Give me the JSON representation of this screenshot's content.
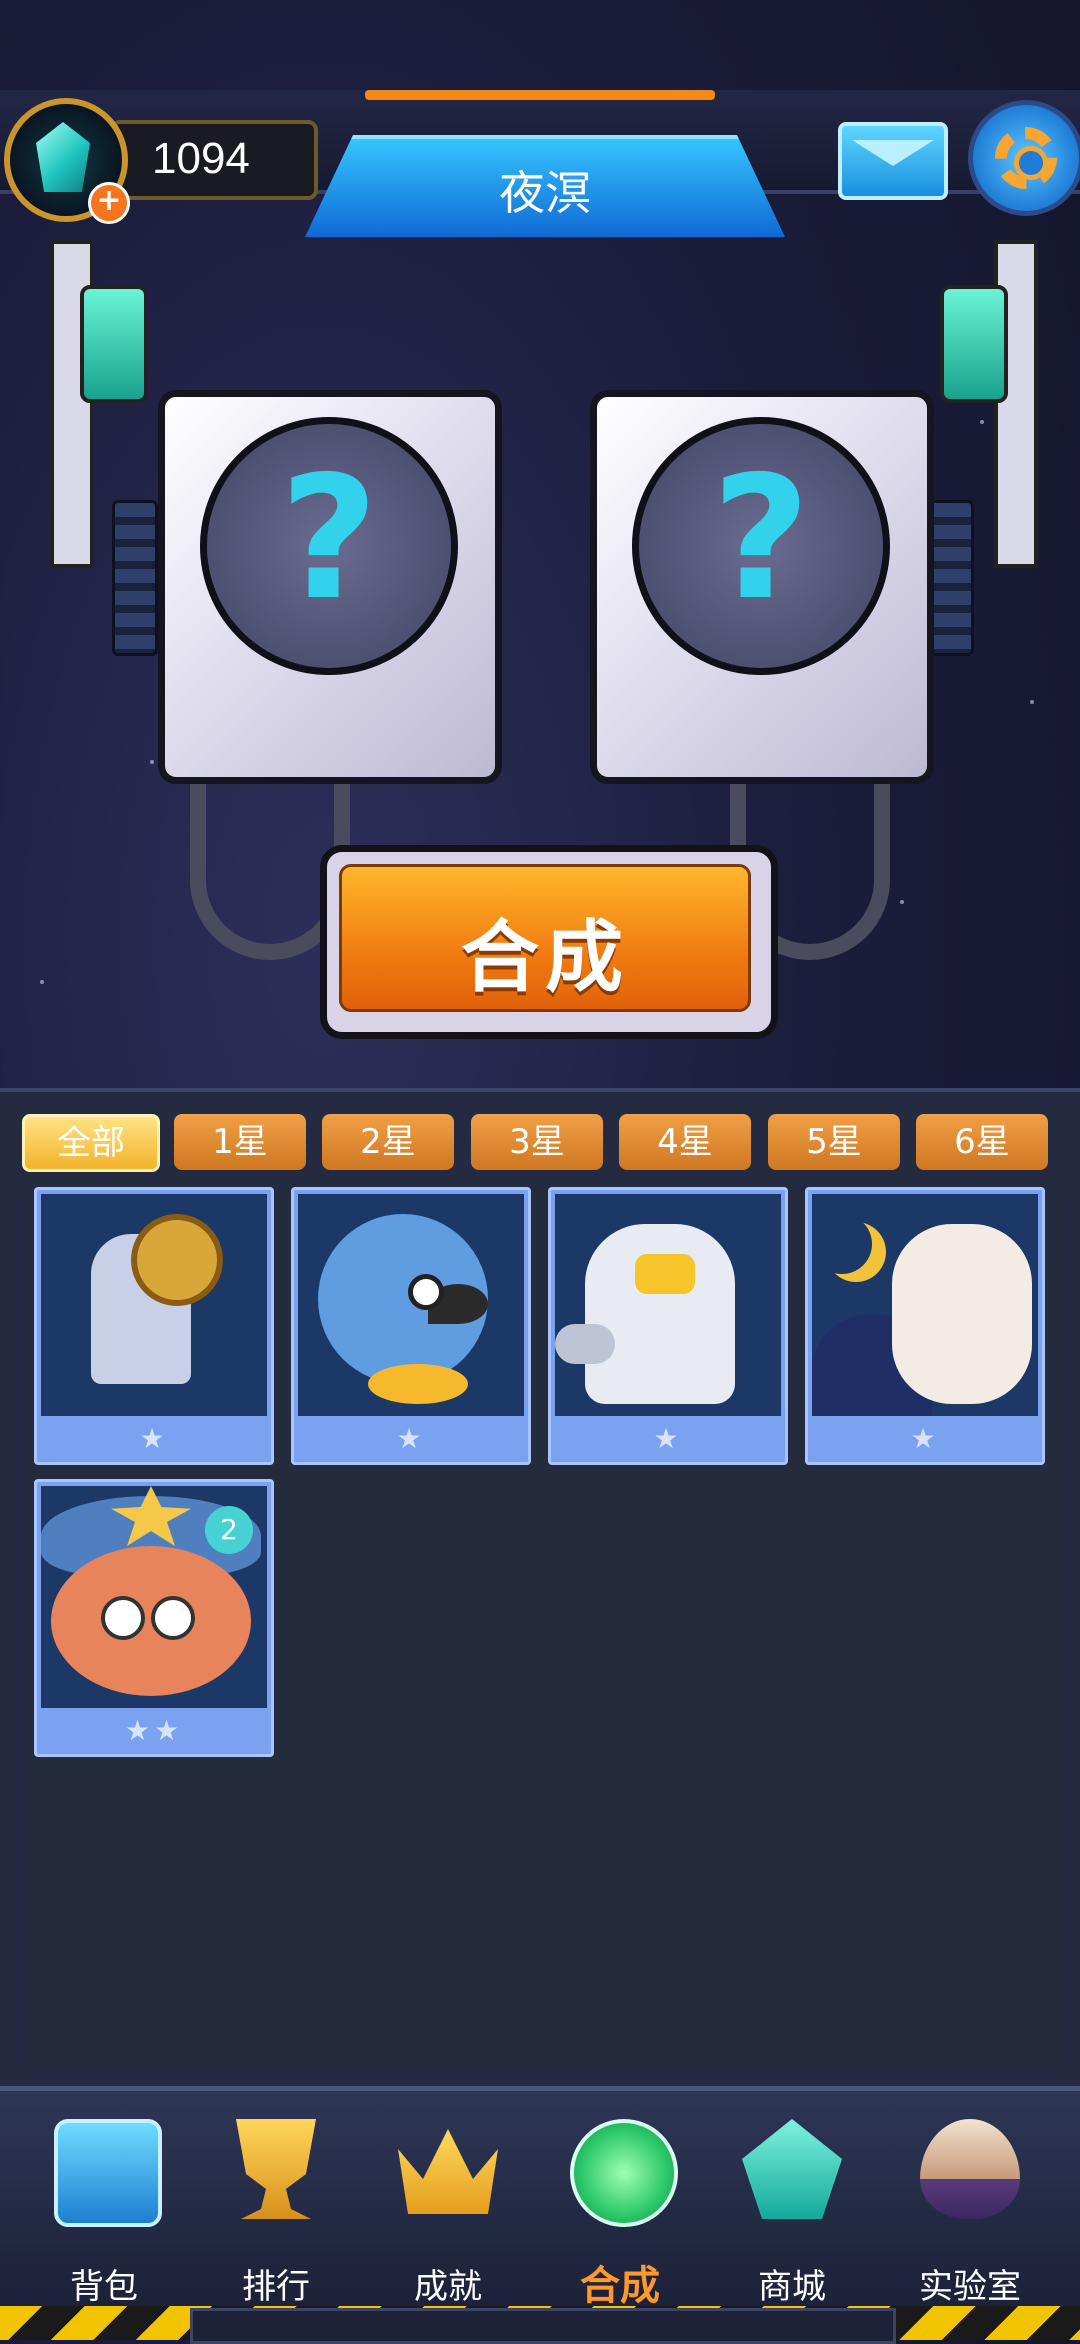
{
  "header": {
    "gem_count": "1094",
    "player_name": "夜溟",
    "icons": {
      "gem": "gem-icon",
      "add": "plus-icon",
      "mail": "mail-icon",
      "settings": "gear-icon"
    }
  },
  "machine": {
    "slot_left_symbol": "?",
    "slot_right_symbol": "?",
    "synthesize_label": "合成"
  },
  "filters": {
    "tabs": [
      {
        "label": "全部",
        "active": true
      },
      {
        "label": "1星",
        "active": false
      },
      {
        "label": "2星",
        "active": false
      },
      {
        "label": "3星",
        "active": false
      },
      {
        "label": "4星",
        "active": false
      },
      {
        "label": "5星",
        "active": false
      },
      {
        "label": "6星",
        "active": false
      }
    ]
  },
  "cards": [
    {
      "art": "robot-girl",
      "stars": "★",
      "star_count": 1
    },
    {
      "art": "parrot",
      "stars": "★",
      "star_count": 1
    },
    {
      "art": "astronaut",
      "stars": "★",
      "star_count": 1
    },
    {
      "art": "moon-bunny",
      "stars": "★",
      "star_count": 1
    },
    {
      "art": "octopus",
      "stars": "★★",
      "star_count": 2,
      "badge": "2"
    }
  ],
  "nav": {
    "items": [
      {
        "label": "背包",
        "icon": "backpack-icon",
        "active": false
      },
      {
        "label": "排行",
        "icon": "trophy-icon",
        "active": false
      },
      {
        "label": "成就",
        "icon": "crown-icon",
        "active": false
      },
      {
        "label": "合成",
        "icon": "flask-icon",
        "active": true
      },
      {
        "label": "商城",
        "icon": "crystal-shop-icon",
        "active": false
      },
      {
        "label": "实验室",
        "icon": "egg-icon",
        "active": false
      }
    ]
  },
  "colors": {
    "accent": "#f28a1a",
    "name_plate": "#1f86e6",
    "card": "#7aa2f0",
    "active_nav": "#ff9a2a"
  }
}
